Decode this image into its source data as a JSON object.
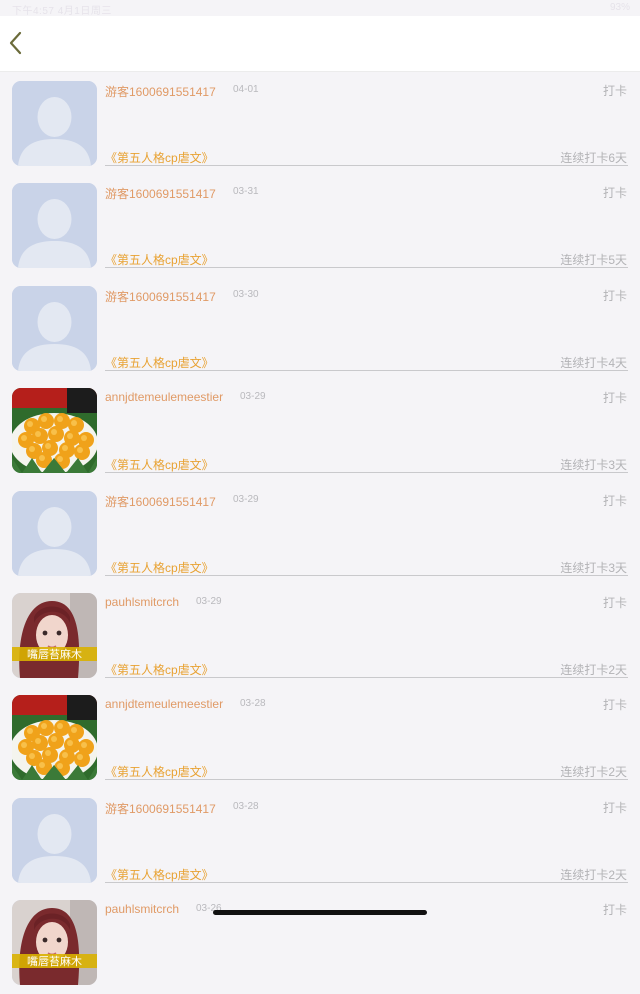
{
  "status_bar": {
    "left_text": "下午4:57  4月1日周三",
    "right_text": "93%"
  },
  "nav": {
    "back_icon": "chevron-left-icon",
    "accent_color": "#6b6b3a"
  },
  "avatars": {
    "default": "default-person-avatar",
    "eggs": "salted-egg-yolk-photo",
    "girl": "girl-portrait-photo",
    "girl_caption": "嘴唇苔麻木"
  },
  "rows": [
    {
      "user": "游客1600691551417",
      "date": "04-01",
      "avatar": "default",
      "action": "打卡",
      "book": "《第五人格cp虐文》",
      "streak": "连续打卡6天"
    },
    {
      "user": "游客1600691551417",
      "date": "03-31",
      "avatar": "default",
      "action": "打卡",
      "book": "《第五人格cp虐文》",
      "streak": "连续打卡5天"
    },
    {
      "user": "游客1600691551417",
      "date": "03-30",
      "avatar": "default",
      "action": "打卡",
      "book": "《第五人格cp虐文》",
      "streak": "连续打卡4天"
    },
    {
      "user": "annjdtemeulemeestier",
      "date": "03-29",
      "avatar": "eggs",
      "action": "打卡",
      "book": "《第五人格cp虐文》",
      "streak": "连续打卡3天"
    },
    {
      "user": "游客1600691551417",
      "date": "03-29",
      "avatar": "default",
      "action": "打卡",
      "book": "《第五人格cp虐文》",
      "streak": "连续打卡3天"
    },
    {
      "user": "pauhlsmitcrch",
      "date": "03-29",
      "avatar": "girl",
      "action": "打卡",
      "book": "《第五人格cp虐文》",
      "streak": "连续打卡2天"
    },
    {
      "user": "annjdtemeulemeestier",
      "date": "03-28",
      "avatar": "eggs",
      "action": "打卡",
      "book": "《第五人格cp虐文》",
      "streak": "连续打卡2天"
    },
    {
      "user": "游客1600691551417",
      "date": "03-28",
      "avatar": "default",
      "action": "打卡",
      "book": "《第五人格cp虐文》",
      "streak": "连续打卡2天"
    },
    {
      "user": "pauhlsmitcrch",
      "date": "03-26",
      "avatar": "girl",
      "action": "打卡",
      "book": "",
      "streak": ""
    }
  ]
}
